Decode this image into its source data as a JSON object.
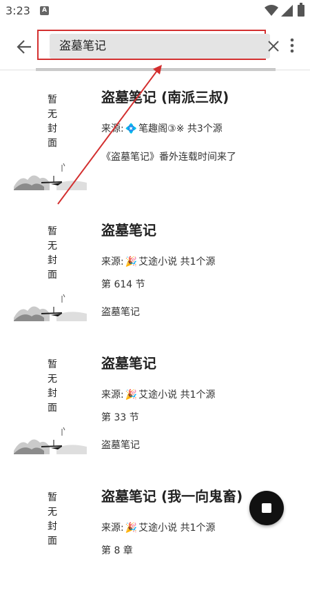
{
  "status_bar": {
    "time": "3:23",
    "notification_icon": "A"
  },
  "toolbar": {
    "back_icon": "arrow-left-icon",
    "search_value": "盗墓笔记",
    "clear_icon": "close-icon",
    "more_icon": "more-vert-icon"
  },
  "results": [
    {
      "cover_text": "暂无封面",
      "title": "盗墓笔记 (南派三叔)",
      "source_prefix": "来源:",
      "source_icon": "💠",
      "source_name": "笔趣阁③※",
      "source_count": "共3个源",
      "chapter": "",
      "intro": "《盗墓笔记》番外连载时间来了"
    },
    {
      "cover_text": "暂无封面",
      "title": "盗墓笔记",
      "source_prefix": "来源:",
      "source_icon": "🎉",
      "source_name": "艾途小说",
      "source_count": "共1个源",
      "chapter": "第 614 节",
      "intro": "盗墓笔记"
    },
    {
      "cover_text": "暂无封面",
      "title": "盗墓笔记",
      "source_prefix": "来源:",
      "source_icon": "🎉",
      "source_name": "艾途小说",
      "source_count": "共1个源",
      "chapter": "第 33 节",
      "intro": "盗墓笔记"
    },
    {
      "cover_text": "暂无封面",
      "title": "盗墓笔记 (我一向鬼畜)",
      "source_prefix": "来源:",
      "source_icon": "🎉",
      "source_name": "艾途小说",
      "source_count": "共1个源",
      "chapter": "第 8 章",
      "intro": ""
    }
  ],
  "fab": {
    "icon": "stop-icon"
  },
  "colors": {
    "annotation": "#d32f2f",
    "search_bg": "#e4e4e4",
    "fab": "#111111"
  }
}
